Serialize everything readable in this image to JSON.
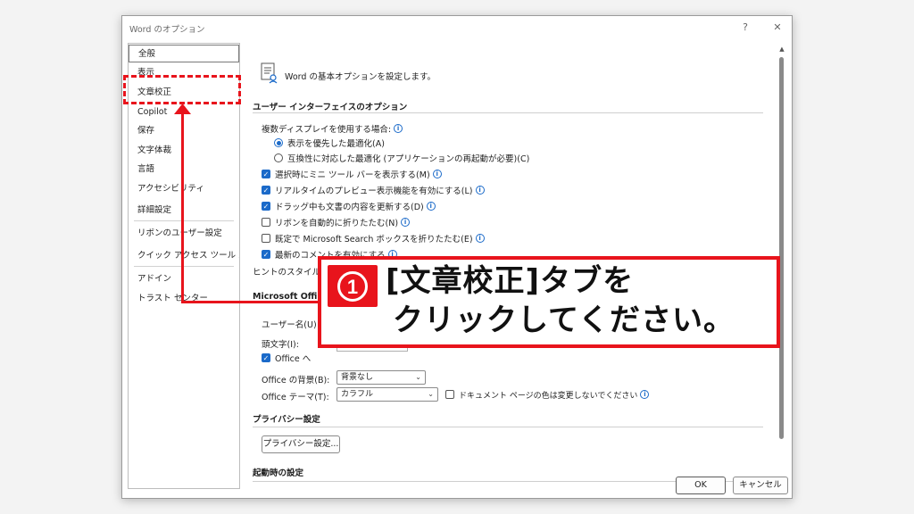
{
  "window": {
    "title": "Word のオプション",
    "help": "?",
    "close": "✕"
  },
  "sidebar": {
    "items": [
      {
        "label": "全般"
      },
      {
        "label": "表示"
      },
      {
        "label": "文章校正"
      },
      {
        "label": "Copilot"
      },
      {
        "label": "保存"
      },
      {
        "label": "文字体裁"
      },
      {
        "label": "言語"
      },
      {
        "label": "アクセシビリティ"
      },
      {
        "label": "詳細設定"
      },
      {
        "label": "リボンのユーザー設定"
      },
      {
        "label": "クイック アクセス ツール バー"
      },
      {
        "label": "アドイン"
      },
      {
        "label": "トラスト センター"
      }
    ]
  },
  "content": {
    "header": "Word の基本オプションを設定します。",
    "ui_section": "ユーザー インターフェイスのオプション",
    "multi_display_label": "複数ディスプレイを使用する場合:",
    "radio_display": "表示を優先した最適化(A)",
    "radio_compat": "互換性に対応した最適化 (アプリケーションの再起動が必要)(C)",
    "chk_mini_toolbar": "選択時にミニ ツール バーを表示する(M)",
    "chk_live_preview": "リアルタイムのプレビュー表示機能を有効にする(L)",
    "chk_drag_update": "ドラッグ中も文書の内容を更新する(D)",
    "chk_ribbon_collapse": "リボンを自動的に折りたたむ(N)",
    "chk_search_collapse": "既定で Microsoft Search ボックスを折りたたむ(E)",
    "chk_comments": "最新のコメントを有効にする",
    "tooltip_style_label": "ヒントのスタイル(R):",
    "ms_office_section": "Microsoft Offi",
    "username_label": "ユーザー名(U)",
    "initials_label": "頭文字(I):",
    "office_always_label": "Office へ",
    "office_background_label": "Office の背景(B):",
    "office_background_value": "背景なし",
    "office_theme_label": "Office テーマ(T):",
    "office_theme_value": "カラフル",
    "chk_doc_page_color": "ドキュメント ページの色は変更しないでください",
    "privacy_section": "プライバシー設定",
    "privacy_button": "プライバシー設定...",
    "startup_section": "起動時の設定"
  },
  "footer": {
    "ok": "OK",
    "cancel": "キャンセル"
  },
  "callout": {
    "number": "1",
    "line1": "[文章校正]タブを",
    "line2": "クリックしてください。"
  },
  "colors": {
    "accent_red": "#e8141c",
    "check_blue": "#1b6ac9"
  }
}
